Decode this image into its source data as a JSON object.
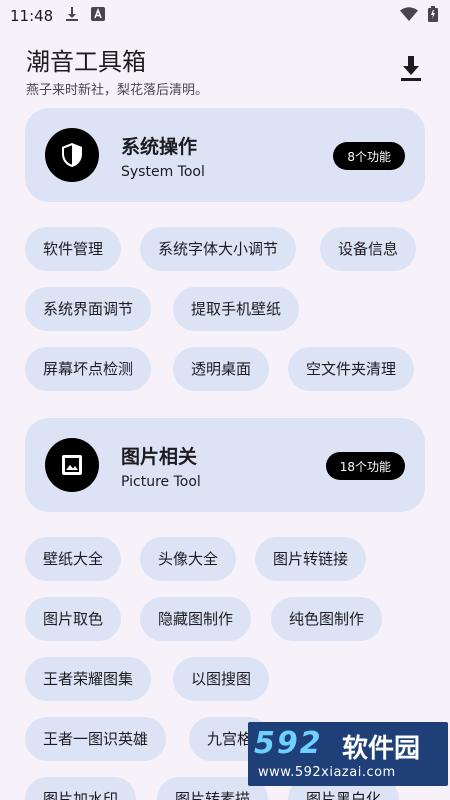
{
  "status_bar": {
    "time": "11:48",
    "icons": [
      "download-notification-icon",
      "a-notification-icon",
      "wifi-icon",
      "battery-icon"
    ]
  },
  "app_bar": {
    "title": "潮音工具箱",
    "subtitle": "燕子来时新社，梨花落后清明。",
    "action_icon": "download-icon"
  },
  "sections": [
    {
      "icon": "shield-icon",
      "title": "系统操作",
      "subtitle": "System Tool",
      "badge": "8个功能",
      "chips": [
        "软件管理",
        "系统字体大小调节",
        "设备信息",
        "系统界面调节",
        "提取手机壁纸",
        "屏幕坏点检测",
        "透明桌面",
        "空文件夹清理"
      ]
    },
    {
      "icon": "image-icon",
      "title": "图片相关",
      "subtitle": "Picture Tool",
      "badge": "18个功能",
      "chips": [
        "壁纸大全",
        "头像大全",
        "图片转链接",
        "图片取色",
        "隐藏图制作",
        "纯色图制作",
        "王者荣耀图集",
        "以图搜图",
        "王者一图识英雄",
        "九宫格",
        "图片加水印",
        "图片转素描",
        "图片黑白化"
      ]
    }
  ],
  "watermark": {
    "number": "592",
    "name": "软件园",
    "url": "www.592xiazai.com"
  },
  "colors": {
    "background": "#f7f2fa",
    "card": "#dce3f5",
    "badge": "#000000"
  }
}
